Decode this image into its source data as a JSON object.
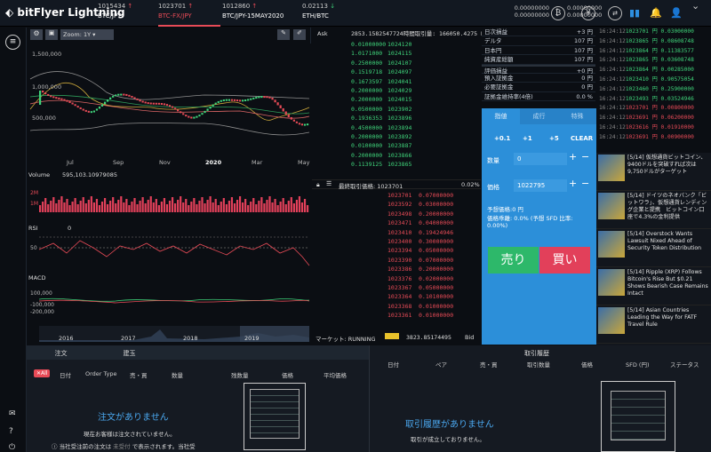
{
  "header": {
    "logo": "bitFlyer Lightning",
    "tickers": [
      {
        "price": "1015434",
        "arrow": "↑",
        "pair": "BTC/JPY"
      },
      {
        "price": "1023701",
        "arrow": "↑",
        "pair": "BTC-FX/JPY"
      },
      {
        "price": "1012860",
        "arrow": "↑",
        "pair": "BTC/JPY-15MAY2020"
      },
      {
        "price": "0.02113",
        "arrow": "↓",
        "pair": "ETH/BTC"
      }
    ],
    "balances": [
      "0.00000000",
      "0.00000000",
      "0.00000000",
      "0.00000000"
    ]
  },
  "chart": {
    "zoom": "Zoom:  1Y",
    "y_ticks": [
      "1,500,000",
      "1,000,000",
      "500,000"
    ],
    "x_ticks": [
      "Jul",
      "Sep",
      "Nov",
      "2020",
      "Mar",
      "May"
    ],
    "volume_label": "Volume",
    "volume_value": "595,103.10979085",
    "vol_ticks": [
      "2M",
      "1M"
    ],
    "rsi_label": "RSI",
    "rsi_value": "0",
    "rsi_ticks": [
      "50"
    ],
    "macd_label": "MACD",
    "macd_ticks": [
      "100,000",
      "-100,000",
      "-200,000"
    ],
    "nav_years": [
      "2016",
      "2017",
      "2018",
      "2019"
    ]
  },
  "book": {
    "ask_label": "Ask",
    "ask_header": "2853.1582547724時間取引量: 166050.4275 B",
    "asks": [
      [
        "0.01000000",
        "1024120"
      ],
      [
        "1.0171000",
        "1024115"
      ],
      [
        "0.2500000",
        "1024107"
      ],
      [
        "0.1519718",
        "1024097"
      ],
      [
        "0.1673597",
        "1024041"
      ],
      [
        "0.2000000",
        "1024029"
      ],
      [
        "0.2000000",
        "1024015"
      ],
      [
        "0.0500000",
        "1023902"
      ],
      [
        "0.1936353",
        "1023896"
      ],
      [
        "0.4500000",
        "1023894"
      ],
      [
        "0.2000000",
        "1023892"
      ],
      [
        "0.0100000",
        "1023887"
      ],
      [
        "0.2000000",
        "1023866"
      ],
      [
        "0.1139125",
        "1023865"
      ]
    ],
    "last_label": "最終取引価格: 1023701",
    "spread": "0.02%",
    "bids": [
      [
        "1023701",
        "0.07000000"
      ],
      [
        "1023592",
        "0.03000000"
      ],
      [
        "1023498",
        "0.20000000"
      ],
      [
        "1023471",
        "0.04000000"
      ],
      [
        "1023410",
        "0.19424946"
      ],
      [
        "1023400",
        "0.30000000"
      ],
      [
        "1023394",
        "0.05000000"
      ],
      [
        "1023390",
        "0.07000000"
      ],
      [
        "1023386",
        "0.20000000"
      ],
      [
        "1023376",
        "0.02000000"
      ],
      [
        "1023367",
        "0.05000000"
      ],
      [
        "1023364",
        "0.10100000"
      ],
      [
        "1023368",
        "0.01000000"
      ],
      [
        "1023361",
        "0.01000000"
      ]
    ],
    "market_label": "マーケット: RUNNING",
    "market_value": "3823.85174495",
    "bid_label": "Bid"
  },
  "account": [
    [
      "日次損益",
      "+3 円"
    ],
    [
      "デルタ",
      "107 円"
    ],
    [
      "日本円",
      "107 円"
    ],
    [
      "純資産総額",
      "107 円"
    ],
    [
      "評価損益",
      "+0 円"
    ],
    [
      "預入証拠金",
      "0 円"
    ],
    [
      "必要証拠金",
      "0 円"
    ],
    [
      "証拠金維持率(4倍)",
      "0.0 %"
    ]
  ],
  "form": {
    "tabs": [
      "指値",
      "成行",
      "特殊"
    ],
    "steps": [
      "+0.1",
      "+1",
      "+5",
      "CLEAR"
    ],
    "qty_label": "数量",
    "qty_value": "0",
    "price_label": "価格",
    "price_value": "1022795",
    "est_price": "予想価格:0 円",
    "margin": "価格乖離: 0.0% (予想 SFD 比率:",
    "margin2": "0.00%)",
    "sell": "売り",
    "buy": "買い"
  },
  "trades": [
    [
      "16:24:12",
      "1023701",
      "0.03000000"
    ],
    [
      "16:24:12",
      "1023865",
      "0.08608748"
    ],
    [
      "16:24:12",
      "1023864",
      "0.11383577"
    ],
    [
      "16:24:12",
      "1023865",
      "0.03608748"
    ],
    [
      "16:24:12",
      "1023864",
      "0.00285000"
    ],
    [
      "16:24:12",
      "1023410",
      "0.90575054"
    ],
    [
      "16:24:12",
      "1023460",
      "0.25900000"
    ],
    [
      "16:24:12",
      "1023493",
      "0.03524946"
    ],
    [
      "16:24:12",
      "1023701",
      "0.00800000"
    ],
    [
      "16:24:12",
      "1023691",
      "0.06200000"
    ],
    [
      "16:24:12",
      "1023616",
      "0.01910000"
    ],
    [
      "16:24:12",
      "1023691",
      "0.00900000"
    ]
  ],
  "news": [
    "[5/14] 仮想通貨ビットコイン、9400ドルを突破すれば次は9,750ドルがターゲット",
    "[5/14] ドイツのネオバンク「ビットワラ」、仮想通貨レンディング企業と提携　ビットコイン口座で4.3%の金利提供",
    "[5/14] Overstock Wants Lawsuit Nixed Ahead of Security Token Distribution",
    "[5/14] Ripple (XRP) Follows Bitcoin's Rise But $0.21 Shows Bearish Case Remains Intact",
    "[5/14] Asian Countries Leading the Way for FATF Travel Rule"
  ],
  "bottom": {
    "tabs": [
      "注文",
      "建玉"
    ],
    "all_badge": "All",
    "cols": [
      "日付",
      "Order Type",
      "売・買",
      "数量",
      "残数量",
      "価格",
      "平均価格"
    ],
    "empty_title": "注文がありません",
    "empty_sub": "現在お客様は注文されていません。",
    "note": "当社受注前の注文は",
    "note2": "で表示されます。当社受",
    "history_title": "取引履歴",
    "hcols": [
      "日付",
      "ペア",
      "売・買",
      "取引数量",
      "価格",
      "SFD (円)",
      "ステータス"
    ],
    "hist_empty": "取引履歴がありません",
    "hist_sub": "取引が成立しておりません。"
  }
}
